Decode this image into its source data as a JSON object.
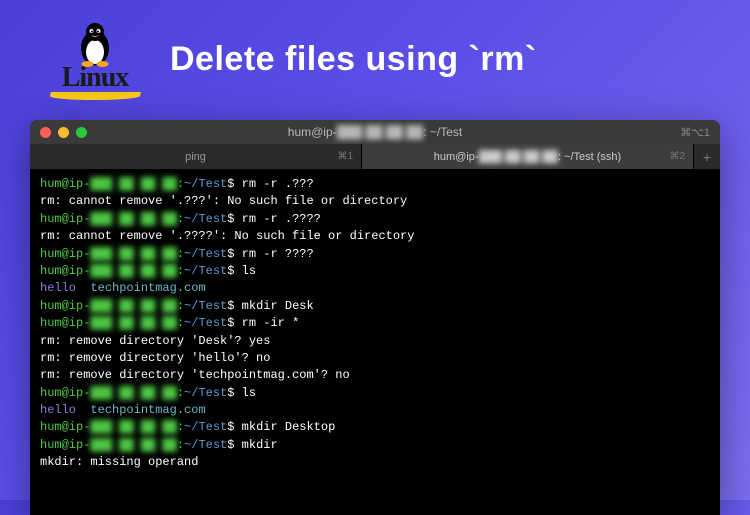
{
  "header": {
    "logo_text": "Linux",
    "title": "Delete files using `rm`"
  },
  "window": {
    "title_prefix": "hum@ip-",
    "title_ip": "███ ██ ██ ██",
    "title_suffix": ": ~/Test",
    "titlebar_shortcut": "⌘⌥1"
  },
  "tabs": [
    {
      "label": "ping",
      "shortcut": "⌘1",
      "active": false
    },
    {
      "label_prefix": "hum@ip-",
      "label_ip": "███ ██ ██ ██",
      "label_suffix": ": ~/Test (ssh)",
      "shortcut": "⌘2",
      "active": true
    }
  ],
  "prompt": {
    "user": "hum@ip-",
    "ip": "███ ██ ██ ██",
    "sep": ":",
    "path": "~/Test",
    "dollar": "$"
  },
  "lines": [
    {
      "type": "cmd",
      "text": "rm -r .???"
    },
    {
      "type": "err",
      "text": "rm: cannot remove '.???': No such file or directory"
    },
    {
      "type": "cmd",
      "text": "rm -r .????"
    },
    {
      "type": "err",
      "text": "rm: cannot remove '.????': No such file or directory"
    },
    {
      "type": "cmd",
      "text": "rm -r ????"
    },
    {
      "type": "cmd",
      "text": "ls"
    },
    {
      "type": "ls",
      "items": [
        "hello",
        "techpointmag.com"
      ]
    },
    {
      "type": "cmd",
      "text": "mkdir Desk"
    },
    {
      "type": "cmd",
      "text": "rm -ir *"
    },
    {
      "type": "err",
      "text": "rm: remove directory 'Desk'? yes"
    },
    {
      "type": "err",
      "text": "rm: remove directory 'hello'? no"
    },
    {
      "type": "err",
      "text": "rm: remove directory 'techpointmag.com'? no"
    },
    {
      "type": "cmd",
      "text": "ls"
    },
    {
      "type": "ls",
      "items": [
        "hello",
        "techpointmag.com"
      ]
    },
    {
      "type": "cmd",
      "text": "mkdir Desktop"
    },
    {
      "type": "cmd",
      "text": "mkdir"
    },
    {
      "type": "err",
      "text": "mkdir: missing operand"
    }
  ]
}
